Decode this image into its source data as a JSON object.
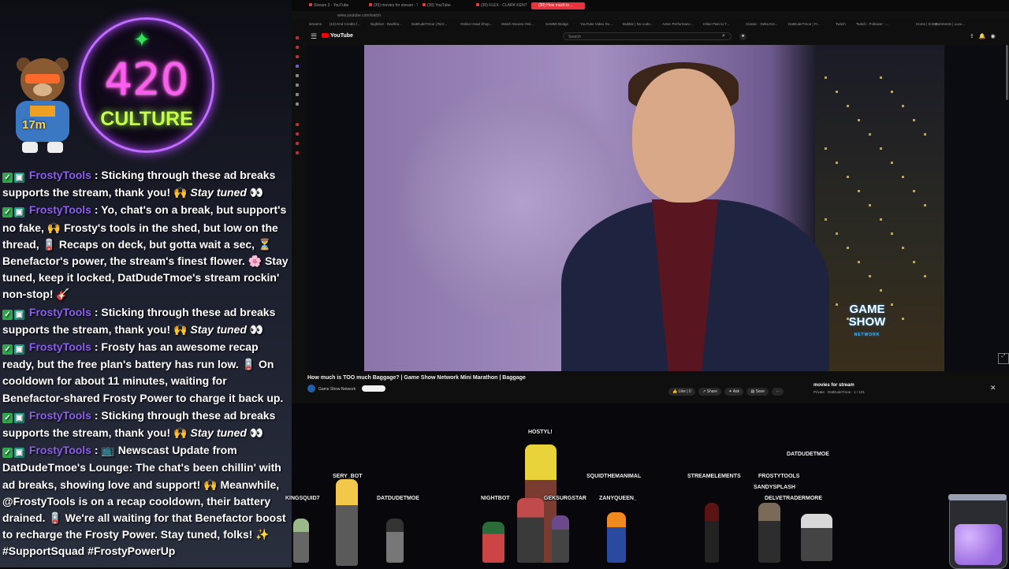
{
  "overlay": {
    "timer": "17m",
    "neon_number": "420",
    "neon_word": "CULTURE"
  },
  "chat": [
    {
      "user": "FrostyTools",
      "text": "Sticking through these ad breaks supports the stream, thank you! 🙌",
      "em": "Stay tuned",
      "tail": "👀"
    },
    {
      "user": "FrostyTools",
      "text": "Yo, chat's on a break, but support's no fake, 🙌 Frosty's tools in the shed, but low on the thread, 🪫 Recaps on deck, but gotta wait a sec, ⏳ Benefactor's power, the stream's finest flower. 🌸 Stay tuned, keep it locked, DatDudeTmoe's stream rockin' non-stop! 🎸",
      "em": "",
      "tail": ""
    },
    {
      "user": "FrostyTools",
      "text": "Sticking through these ad breaks supports the stream, thank you! 🙌",
      "em": "Stay tuned",
      "tail": "👀"
    },
    {
      "user": "FrostyTools",
      "text": "Frosty has an awesome recap ready, but the free plan's battery has run low. 🪫 On cooldown for about 11 minutes, waiting for Benefactor-shared Frosty Power to charge it back up.",
      "em": "",
      "tail": ""
    },
    {
      "user": "FrostyTools",
      "text": "Sticking through these ad breaks supports the stream, thank you! 🙌",
      "em": "Stay tuned",
      "tail": "👀"
    },
    {
      "user": "FrostyTools",
      "text": "📺 Newscast Update from DatDudeTmoe's Lounge: The chat's been chillin' with ad breaks, showing love and support! 🙌 Meanwhile, @FrostyTools is on a recap cooldown, their battery drained. 🪫 We're all waiting for that Benefactor boost to recharge the Frosty Power. Stay tuned, folks! ✨ #SupportSquad #FrostyPowerUp",
      "em": "",
      "tail": ""
    }
  ],
  "browser": {
    "tabs": [
      {
        "label": "Stream 3 - YouTube",
        "active": false
      },
      {
        "label": "(30) movies for stream - Y...",
        "active": false
      },
      {
        "label": "(30) YouTube",
        "active": false
      },
      {
        "label": "(30) FLEX - CLARK KENT...",
        "active": false
      },
      {
        "label": "(30) How much is ...",
        "active": true
      }
    ],
    "url": "www.youtube.com/watch",
    "bookmarks": [
      "streams",
      "(10) End Credits f...",
      "Nightbot - Dashbo...",
      "DatDudeTmoe | Rizz...",
      "Online Head Shop...",
      "Watch Movies Onli...",
      "SAMMI Bridge",
      "YouTube Video Do...",
      "Bubble | No-code...",
      "Aztec Performanc...",
      "Inline Pain to T...",
      "Classic - Delta Ext...",
      "DatDudeTmoe | Fr...",
      "Twitch",
      "Twitch - Follower - ...",
      "Home | D.E.P.",
      "Apartments | Luxu..."
    ]
  },
  "youtube": {
    "logo": "YouTube",
    "search_placeholder": "Search",
    "video_title": "How much is TOO much Baggage? | Game Show Network Mini Marathon | Baggage",
    "channel": "Game Show Network",
    "actions": {
      "like": "Like",
      "dislike": "0",
      "share": "Share",
      "ask": "Ask",
      "save": "Save",
      "more": "⋯"
    },
    "playlist_title": "movies for stream",
    "playlist_sub": "Private · DatDudeTmoe - 1 / 101",
    "gsn_logo_top": "GAME",
    "gsn_logo_bottom": "SHOW",
    "gsn_logo_sub": "NETWORK"
  },
  "stage": {
    "usernames": [
      {
        "name": "HOSTYL!"
      },
      {
        "name": "DATDUDETMOE"
      },
      {
        "name": "SERY_BOT"
      },
      {
        "name": "SQUIDTHEMANIMAL"
      },
      {
        "name": "STREAMELEMENTS"
      },
      {
        "name": "FROSTYTOOLS"
      },
      {
        "name": "KINGSQUID7"
      },
      {
        "name": "DATDUDETMOE"
      },
      {
        "name": "NIGHTBOT"
      },
      {
        "name": "GEKSURGSTAR"
      },
      {
        "name": "ZANYQUEEN_"
      },
      {
        "name": "SANDYSPLASH"
      },
      {
        "name": "DELVETRADERMORE"
      }
    ]
  },
  "colors": {
    "username": "#8c5ef0",
    "neon_pink": "#ff5cf0",
    "neon_green": "#c6ff4d",
    "yt_red": "#ff0000"
  }
}
